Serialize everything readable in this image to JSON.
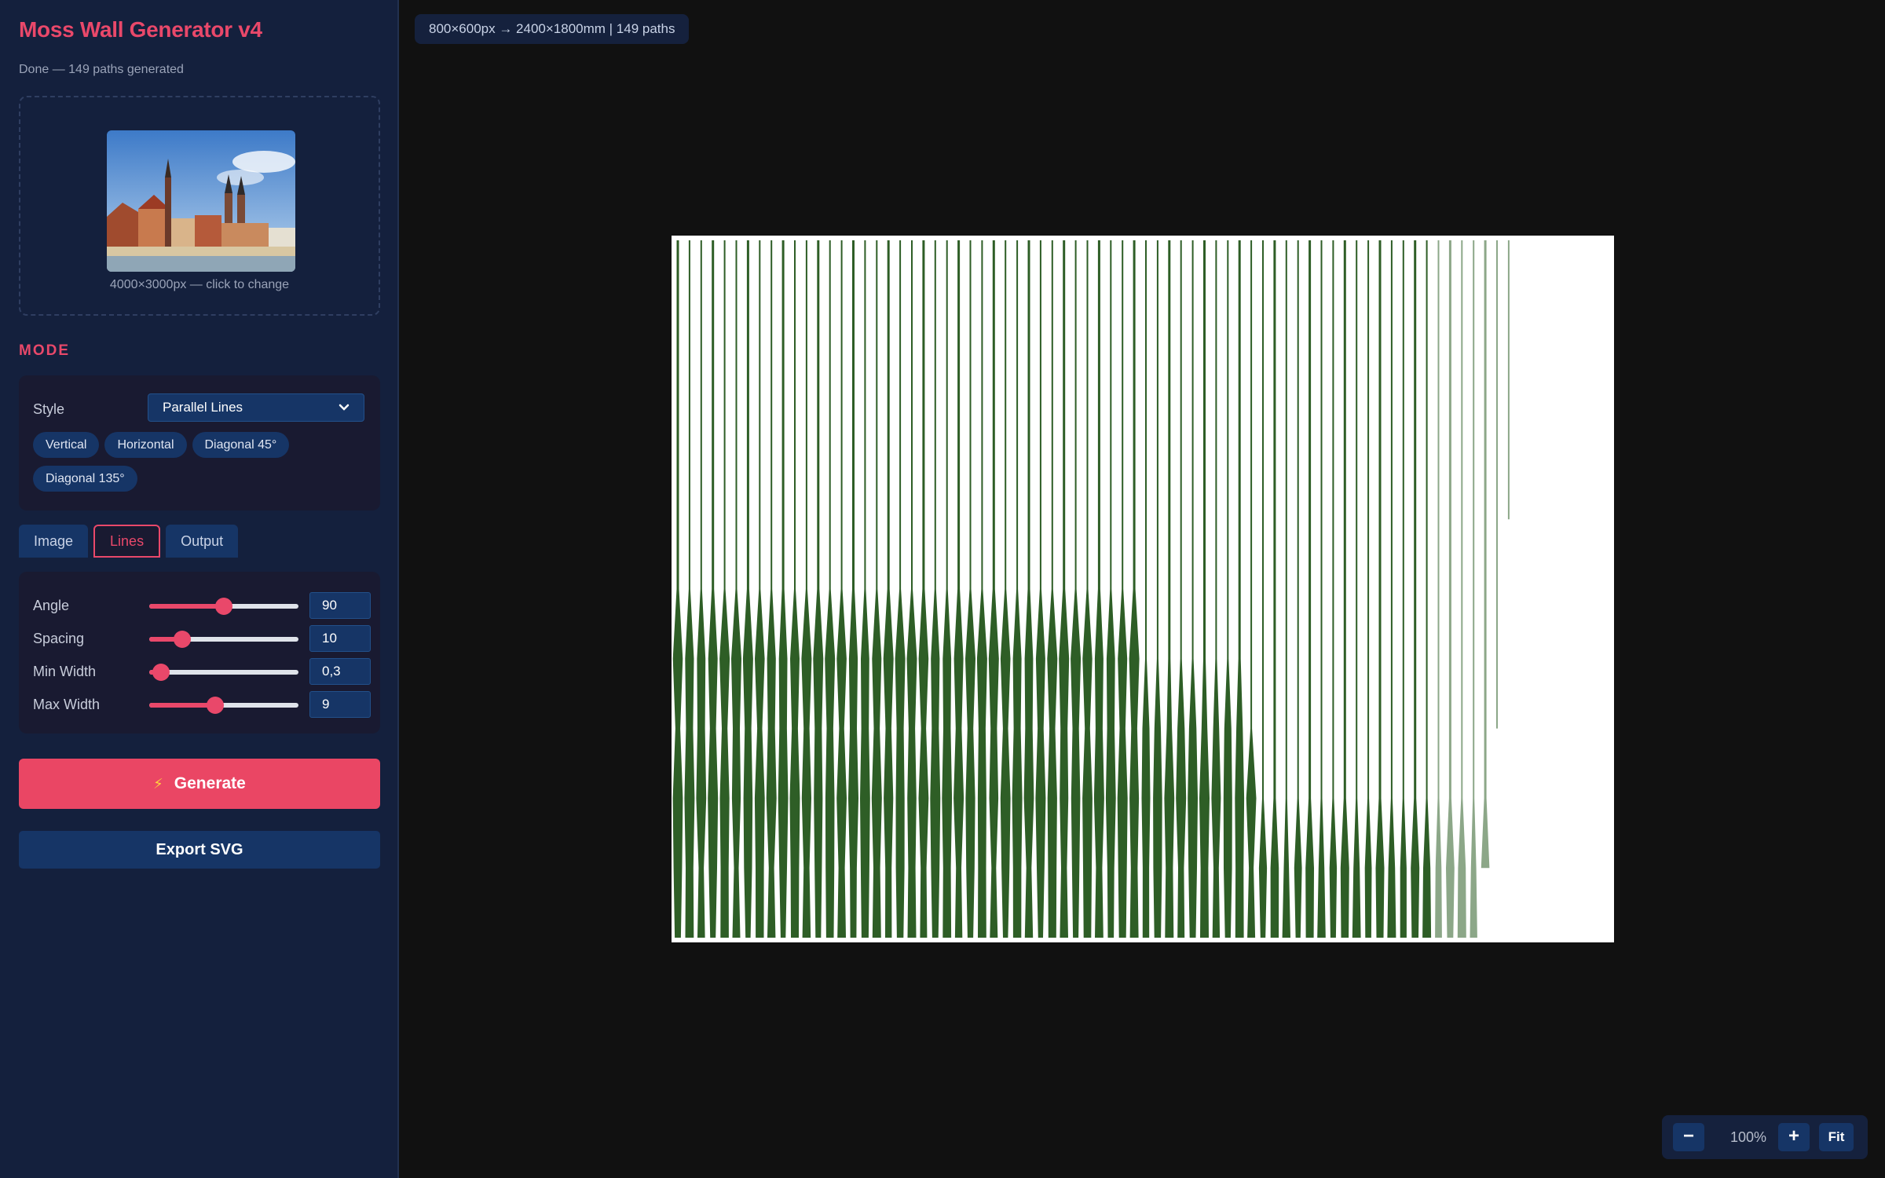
{
  "app": {
    "title": "Moss Wall Generator v4",
    "status": "Done — 149 paths generated"
  },
  "upload": {
    "caption": "4000×3000px — click to change"
  },
  "mode": {
    "section_label": "MODE",
    "style_label": "Style",
    "style_value": "Parallel Lines",
    "presets": [
      "Vertical",
      "Horizontal",
      "Diagonal 45°",
      "Diagonal 135°"
    ]
  },
  "tabs": [
    {
      "label": "Image",
      "active": false
    },
    {
      "label": "Lines",
      "active": true
    },
    {
      "label": "Output",
      "active": false
    }
  ],
  "lines": {
    "angle": {
      "label": "Angle",
      "value": "90",
      "level": 0.5
    },
    "spacing": {
      "label": "Spacing",
      "value": "10",
      "level": 0.22
    },
    "min_width": {
      "label": "Min Width",
      "value": "0,3",
      "level": 0.08
    },
    "max_width": {
      "label": "Max Width",
      "value": "9",
      "level": 0.44
    }
  },
  "actions": {
    "generate_label": "Generate",
    "export_label": "Export SVG"
  },
  "canvas": {
    "info": "800×600px → 2400×1800mm | 149 paths",
    "path_color": "#2e5e26",
    "path_count": 149
  },
  "zoom": {
    "minus": "−",
    "level": "100%",
    "plus": "+",
    "fit": "Fit"
  },
  "colors": {
    "accent": "#e9486a",
    "sidebar_bg": "#14203d",
    "workspace_bg": "#111111",
    "control_bg": "#163566"
  }
}
